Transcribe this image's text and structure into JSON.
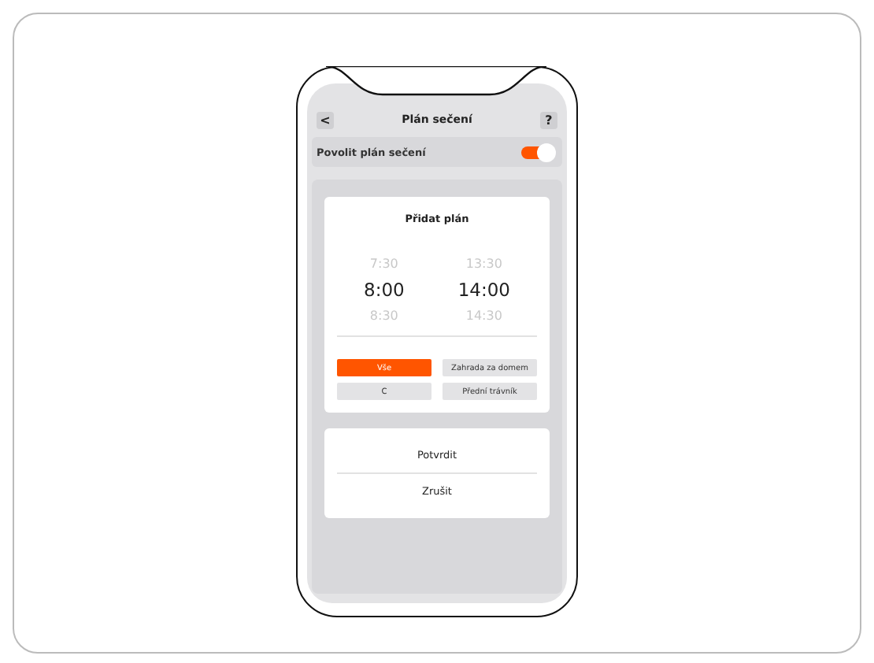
{
  "header": {
    "back": "<",
    "title": "Plán sečení",
    "help": "?"
  },
  "enable": {
    "label": "Povolit plán sečení",
    "on": true
  },
  "add_plan": {
    "title": "Přidat plán",
    "pickers": [
      {
        "items": [
          {
            "label": "7:30",
            "selected": false
          },
          {
            "label": "8:00",
            "selected": true
          },
          {
            "label": "8:30",
            "selected": false
          }
        ]
      },
      {
        "items": [
          {
            "label": "13:30",
            "selected": false
          },
          {
            "label": "14:00",
            "selected": true
          },
          {
            "label": "14:30",
            "selected": false
          }
        ]
      }
    ],
    "zones": [
      {
        "label": "Vše",
        "selected": true
      },
      {
        "label": "Zahrada za domem",
        "selected": false
      },
      {
        "label": "C",
        "selected": false
      },
      {
        "label": "Přední trávník",
        "selected": false
      }
    ]
  },
  "actions": [
    "Potvrdit",
    "Zrušit"
  ]
}
